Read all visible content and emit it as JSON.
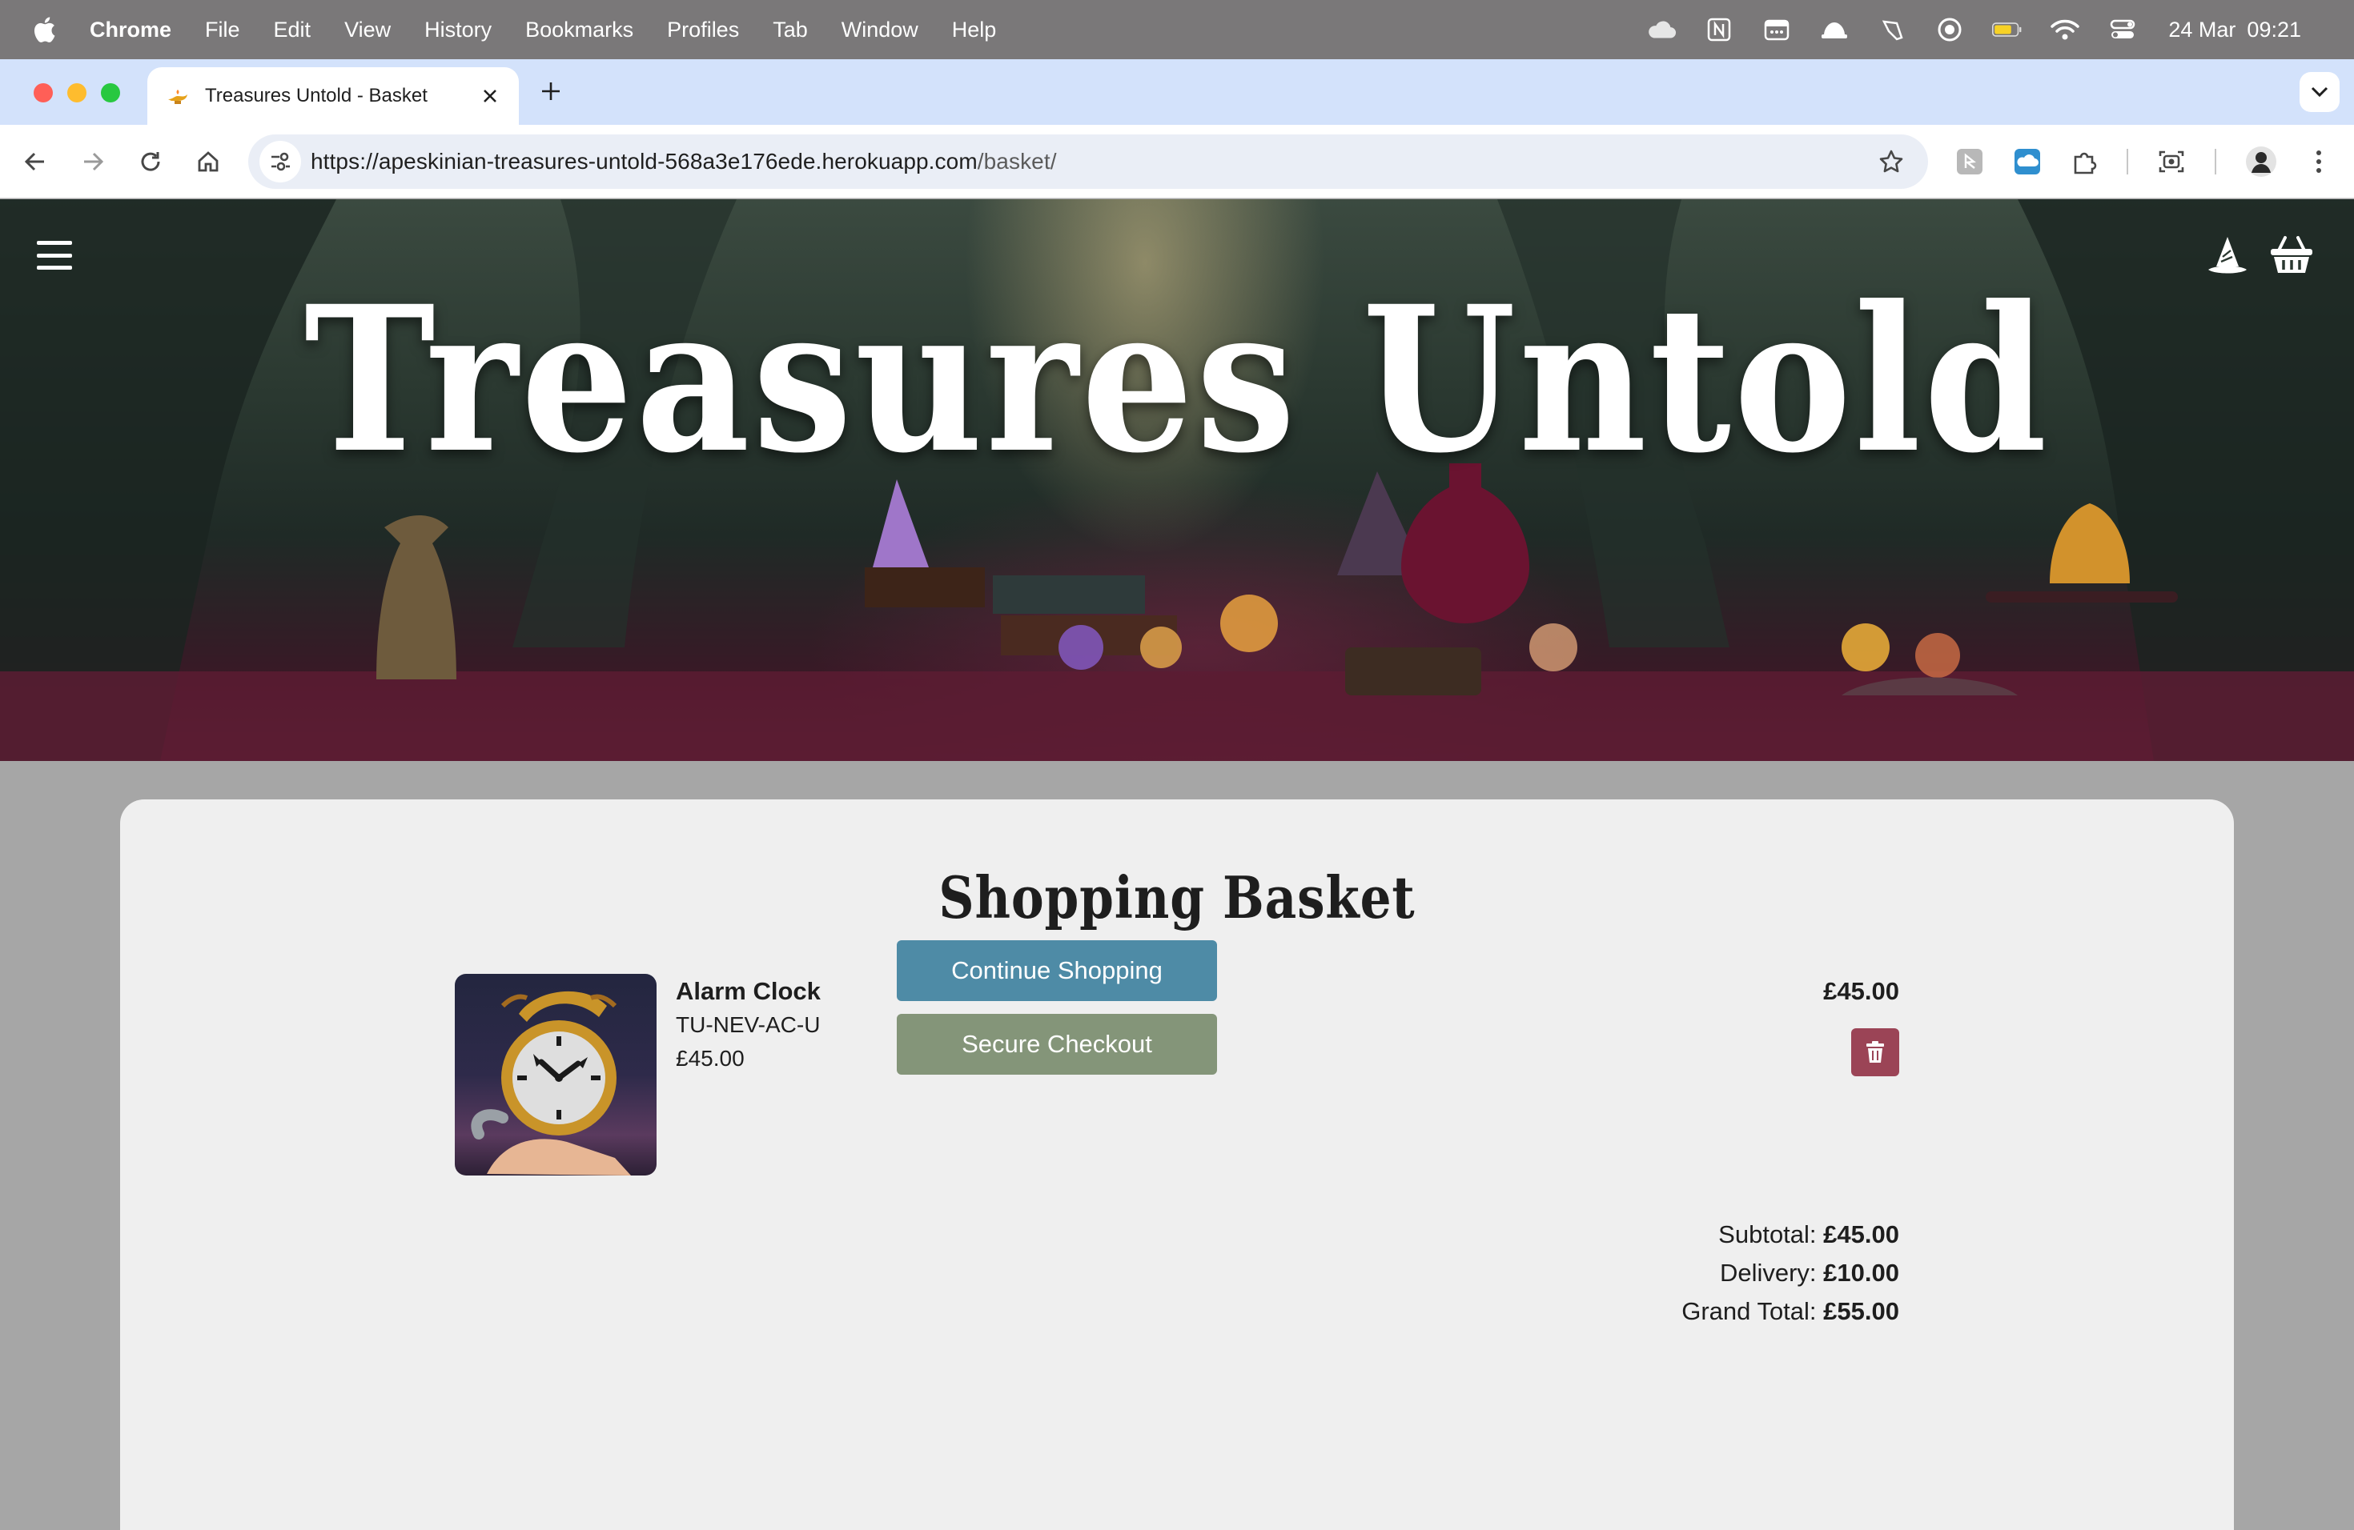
{
  "menubar": {
    "app_name": "Chrome",
    "items": [
      "File",
      "Edit",
      "View",
      "History",
      "Bookmarks",
      "Profiles",
      "Tab",
      "Window",
      "Help"
    ],
    "date": "24 Mar",
    "time": "09:21"
  },
  "browser": {
    "tab_title": "Treasures Untold - Basket",
    "url_host": "https://apeskinian-treasures-untold-568a3e176ede.herokuapp.com",
    "url_path": "/basket/"
  },
  "site": {
    "brand": "Treasures Untold"
  },
  "basket": {
    "heading": "Shopping Basket",
    "items": [
      {
        "name": "Alarm Clock",
        "sku": "TU-NEV-AC-U",
        "price": "£45.00",
        "line_total": "£45.00"
      }
    ],
    "subtotal_label": "Subtotal:",
    "subtotal": "£45.00",
    "delivery_label": "Delivery:",
    "delivery": "£10.00",
    "grand_total_label": "Grand Total:",
    "grand_total": "£55.00",
    "continue_label": "Continue Shopping",
    "checkout_label": "Secure Checkout"
  },
  "colors": {
    "continue_button": "#4e8ba6",
    "checkout_button": "#849579",
    "remove_button": "#9b4456",
    "card_background": "#efefef"
  }
}
